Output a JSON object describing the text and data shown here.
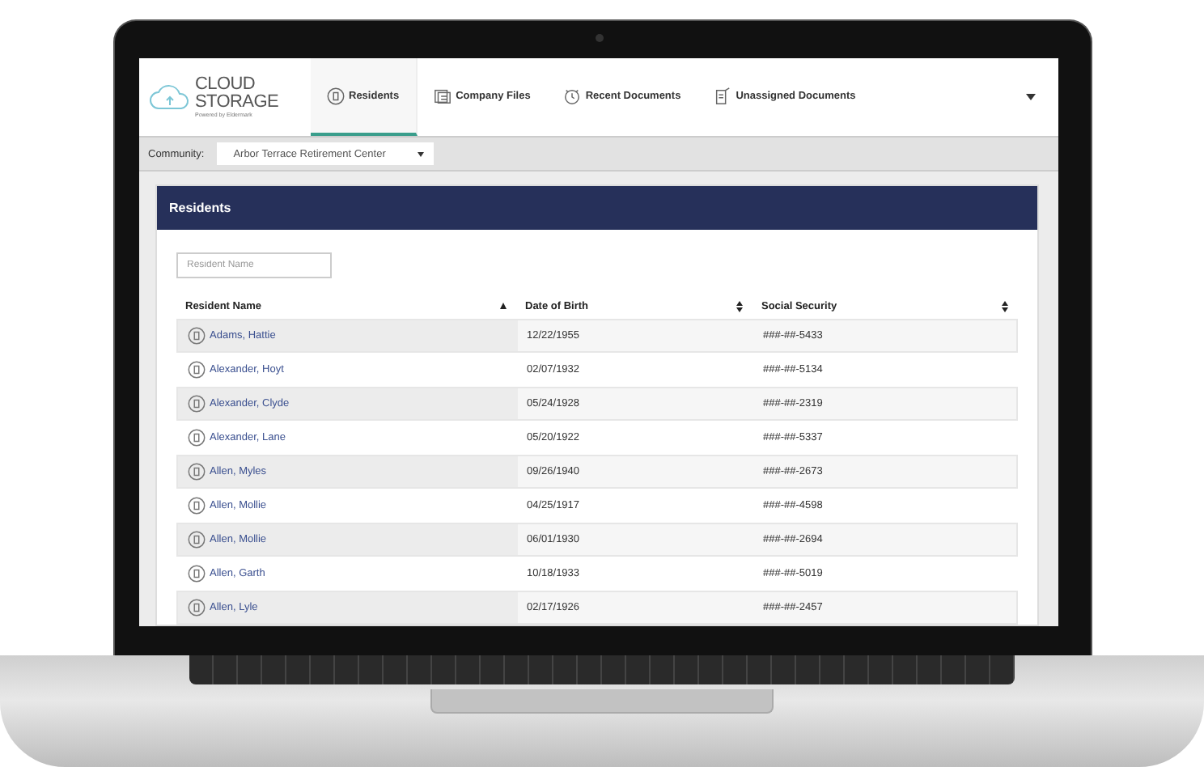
{
  "app": {
    "logo": {
      "line_1": "CLOUD",
      "line_2": "STORAGE",
      "tagline": "Powered by Eldermark"
    },
    "tabs": [
      {
        "label": "Residents",
        "selected": true
      },
      {
        "label": "Company Files",
        "selected": false
      },
      {
        "label": "Recent Documents",
        "selected": false
      },
      {
        "label": "Unassigned Documents",
        "selected": false
      }
    ],
    "community": {
      "label": "Community:",
      "value": "Arbor Terrace Retirement Center"
    },
    "panel": {
      "title": "Residents",
      "search": {
        "placeholder": "Resident Name"
      },
      "columns": [
        {
          "label": "Resident Name",
          "sorted": true
        },
        {
          "label": "Date of Birth",
          "sorted": false
        },
        {
          "label": "Social Security",
          "sorted": false
        }
      ],
      "rows": [
        {
          "name": "Adams, Hattie",
          "dob": "12/22/1955",
          "ssn": "###-##-5433"
        },
        {
          "name": "Alexander, Hoyt",
          "dob": "02/07/1932",
          "ssn": "###-##-5134"
        },
        {
          "name": "Alexander, Clyde",
          "dob": "05/24/1928",
          "ssn": "###-##-2319"
        },
        {
          "name": "Alexander, Lane",
          "dob": "05/20/1922",
          "ssn": "###-##-5337"
        },
        {
          "name": "Allen, Myles",
          "dob": "09/26/1940",
          "ssn": "###-##-2673"
        },
        {
          "name": "Allen, Mollie",
          "dob": "04/25/1917",
          "ssn": "###-##-4598"
        },
        {
          "name": "Allen, Mollie",
          "dob": "06/01/1930",
          "ssn": "###-##-2694"
        },
        {
          "name": "Allen, Garth",
          "dob": "10/18/1933",
          "ssn": "###-##-5019"
        },
        {
          "name": "Allen, Lyle",
          "dob": "02/17/1926",
          "ssn": "###-##-2457"
        }
      ]
    }
  }
}
